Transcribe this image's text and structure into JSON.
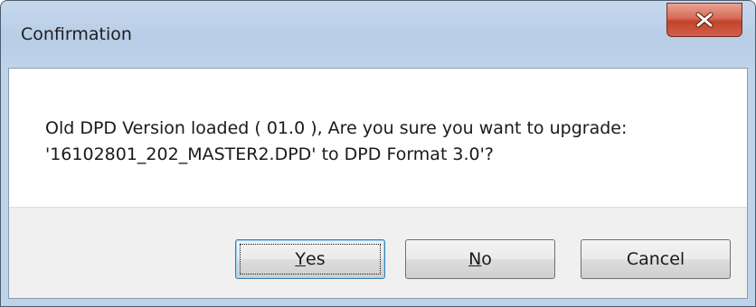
{
  "window": {
    "title": "Confirmation"
  },
  "message": {
    "line1": "Old DPD Version loaded ( 01.0 ), Are you sure you want to upgrade:",
    "line2": "'16102801_202_MASTER2.DPD' to DPD Format 3.0'?"
  },
  "buttons": {
    "yes": {
      "mnemonic": "Y",
      "rest": "es"
    },
    "no": {
      "mnemonic": "N",
      "rest": "o"
    },
    "cancel": {
      "label": "Cancel"
    }
  },
  "icons": {
    "close": "close-icon"
  },
  "colors": {
    "titlebar": "#bed2ea",
    "close_button": "#c2432c",
    "button_area": "#f0f0f0",
    "default_button_border": "#3c7fb1"
  }
}
